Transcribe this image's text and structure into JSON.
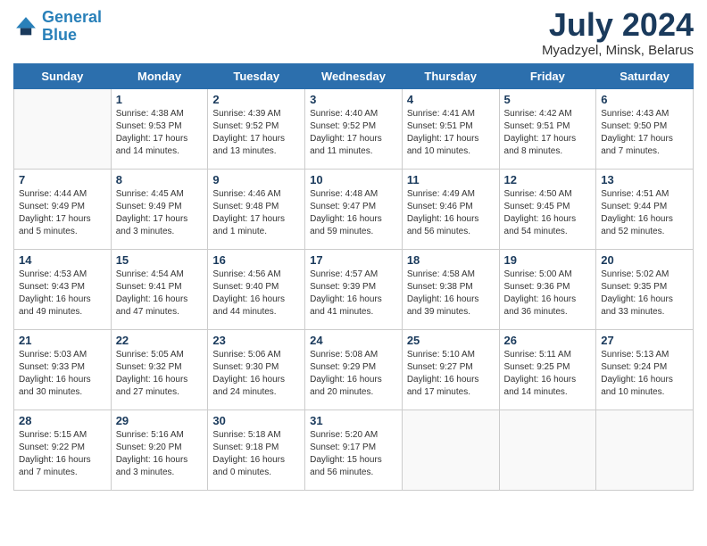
{
  "header": {
    "logo_line1": "General",
    "logo_line2": "Blue",
    "month_title": "July 2024",
    "location": "Myadzyel, Minsk, Belarus"
  },
  "weekdays": [
    "Sunday",
    "Monday",
    "Tuesday",
    "Wednesday",
    "Thursday",
    "Friday",
    "Saturday"
  ],
  "weeks": [
    [
      {
        "day": "",
        "info": ""
      },
      {
        "day": "1",
        "info": "Sunrise: 4:38 AM\nSunset: 9:53 PM\nDaylight: 17 hours\nand 14 minutes."
      },
      {
        "day": "2",
        "info": "Sunrise: 4:39 AM\nSunset: 9:52 PM\nDaylight: 17 hours\nand 13 minutes."
      },
      {
        "day": "3",
        "info": "Sunrise: 4:40 AM\nSunset: 9:52 PM\nDaylight: 17 hours\nand 11 minutes."
      },
      {
        "day": "4",
        "info": "Sunrise: 4:41 AM\nSunset: 9:51 PM\nDaylight: 17 hours\nand 10 minutes."
      },
      {
        "day": "5",
        "info": "Sunrise: 4:42 AM\nSunset: 9:51 PM\nDaylight: 17 hours\nand 8 minutes."
      },
      {
        "day": "6",
        "info": "Sunrise: 4:43 AM\nSunset: 9:50 PM\nDaylight: 17 hours\nand 7 minutes."
      }
    ],
    [
      {
        "day": "7",
        "info": "Sunrise: 4:44 AM\nSunset: 9:49 PM\nDaylight: 17 hours\nand 5 minutes."
      },
      {
        "day": "8",
        "info": "Sunrise: 4:45 AM\nSunset: 9:49 PM\nDaylight: 17 hours\nand 3 minutes."
      },
      {
        "day": "9",
        "info": "Sunrise: 4:46 AM\nSunset: 9:48 PM\nDaylight: 17 hours\nand 1 minute."
      },
      {
        "day": "10",
        "info": "Sunrise: 4:48 AM\nSunset: 9:47 PM\nDaylight: 16 hours\nand 59 minutes."
      },
      {
        "day": "11",
        "info": "Sunrise: 4:49 AM\nSunset: 9:46 PM\nDaylight: 16 hours\nand 56 minutes."
      },
      {
        "day": "12",
        "info": "Sunrise: 4:50 AM\nSunset: 9:45 PM\nDaylight: 16 hours\nand 54 minutes."
      },
      {
        "day": "13",
        "info": "Sunrise: 4:51 AM\nSunset: 9:44 PM\nDaylight: 16 hours\nand 52 minutes."
      }
    ],
    [
      {
        "day": "14",
        "info": "Sunrise: 4:53 AM\nSunset: 9:43 PM\nDaylight: 16 hours\nand 49 minutes."
      },
      {
        "day": "15",
        "info": "Sunrise: 4:54 AM\nSunset: 9:41 PM\nDaylight: 16 hours\nand 47 minutes."
      },
      {
        "day": "16",
        "info": "Sunrise: 4:56 AM\nSunset: 9:40 PM\nDaylight: 16 hours\nand 44 minutes."
      },
      {
        "day": "17",
        "info": "Sunrise: 4:57 AM\nSunset: 9:39 PM\nDaylight: 16 hours\nand 41 minutes."
      },
      {
        "day": "18",
        "info": "Sunrise: 4:58 AM\nSunset: 9:38 PM\nDaylight: 16 hours\nand 39 minutes."
      },
      {
        "day": "19",
        "info": "Sunrise: 5:00 AM\nSunset: 9:36 PM\nDaylight: 16 hours\nand 36 minutes."
      },
      {
        "day": "20",
        "info": "Sunrise: 5:02 AM\nSunset: 9:35 PM\nDaylight: 16 hours\nand 33 minutes."
      }
    ],
    [
      {
        "day": "21",
        "info": "Sunrise: 5:03 AM\nSunset: 9:33 PM\nDaylight: 16 hours\nand 30 minutes."
      },
      {
        "day": "22",
        "info": "Sunrise: 5:05 AM\nSunset: 9:32 PM\nDaylight: 16 hours\nand 27 minutes."
      },
      {
        "day": "23",
        "info": "Sunrise: 5:06 AM\nSunset: 9:30 PM\nDaylight: 16 hours\nand 24 minutes."
      },
      {
        "day": "24",
        "info": "Sunrise: 5:08 AM\nSunset: 9:29 PM\nDaylight: 16 hours\nand 20 minutes."
      },
      {
        "day": "25",
        "info": "Sunrise: 5:10 AM\nSunset: 9:27 PM\nDaylight: 16 hours\nand 17 minutes."
      },
      {
        "day": "26",
        "info": "Sunrise: 5:11 AM\nSunset: 9:25 PM\nDaylight: 16 hours\nand 14 minutes."
      },
      {
        "day": "27",
        "info": "Sunrise: 5:13 AM\nSunset: 9:24 PM\nDaylight: 16 hours\nand 10 minutes."
      }
    ],
    [
      {
        "day": "28",
        "info": "Sunrise: 5:15 AM\nSunset: 9:22 PM\nDaylight: 16 hours\nand 7 minutes."
      },
      {
        "day": "29",
        "info": "Sunrise: 5:16 AM\nSunset: 9:20 PM\nDaylight: 16 hours\nand 3 minutes."
      },
      {
        "day": "30",
        "info": "Sunrise: 5:18 AM\nSunset: 9:18 PM\nDaylight: 16 hours\nand 0 minutes."
      },
      {
        "day": "31",
        "info": "Sunrise: 5:20 AM\nSunset: 9:17 PM\nDaylight: 15 hours\nand 56 minutes."
      },
      {
        "day": "",
        "info": ""
      },
      {
        "day": "",
        "info": ""
      },
      {
        "day": "",
        "info": ""
      }
    ]
  ]
}
